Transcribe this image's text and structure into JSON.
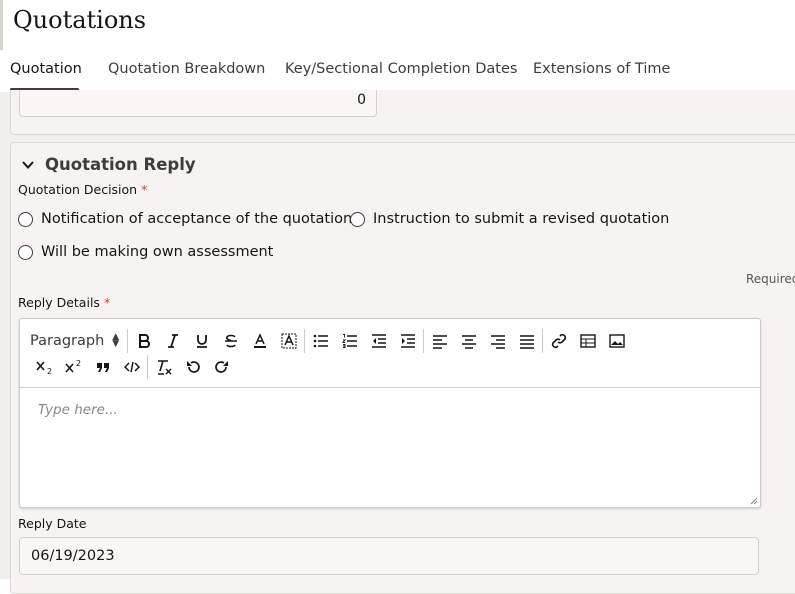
{
  "page": {
    "title": "Quotations"
  },
  "tabs": [
    {
      "label": "Quotation",
      "active": true
    },
    {
      "label": "Quotation Breakdown",
      "active": false
    },
    {
      "label": "Key/Sectional Completion Dates",
      "active": false
    },
    {
      "label": "Extensions of Time",
      "active": false
    }
  ],
  "previous_field": {
    "value": "0"
  },
  "reply_section": {
    "title": "Quotation Reply",
    "decision_label": "Quotation Decision",
    "required_marker": "*",
    "options": [
      "Notification of acceptance of the quotation",
      "Instruction to submit a revised quotation",
      "Will be making own assessment"
    ],
    "required_hint": "Required",
    "reply_details_label": "Reply Details",
    "editor": {
      "paragraph_select": "Paragraph",
      "placeholder": "Type here...",
      "toolbar_icons": [
        "bold-icon",
        "italic-icon",
        "underline-icon",
        "strikethrough-icon",
        "font-color-icon",
        "highlight-color-icon",
        "bulleted-list-icon",
        "numbered-list-icon",
        "outdent-icon",
        "indent-icon",
        "align-left-icon",
        "align-center-icon",
        "align-right-icon",
        "justify-icon",
        "link-icon",
        "table-icon",
        "image-icon",
        "subscript-icon",
        "superscript-icon",
        "blockquote-icon",
        "code-icon",
        "clear-format-icon",
        "undo-icon",
        "redo-icon"
      ]
    },
    "reply_date_label": "Reply Date",
    "reply_date_value": "06/19/2023"
  },
  "colors": {
    "accent": "#3f3c39",
    "required": "#c74634",
    "background": "#f1efed"
  }
}
